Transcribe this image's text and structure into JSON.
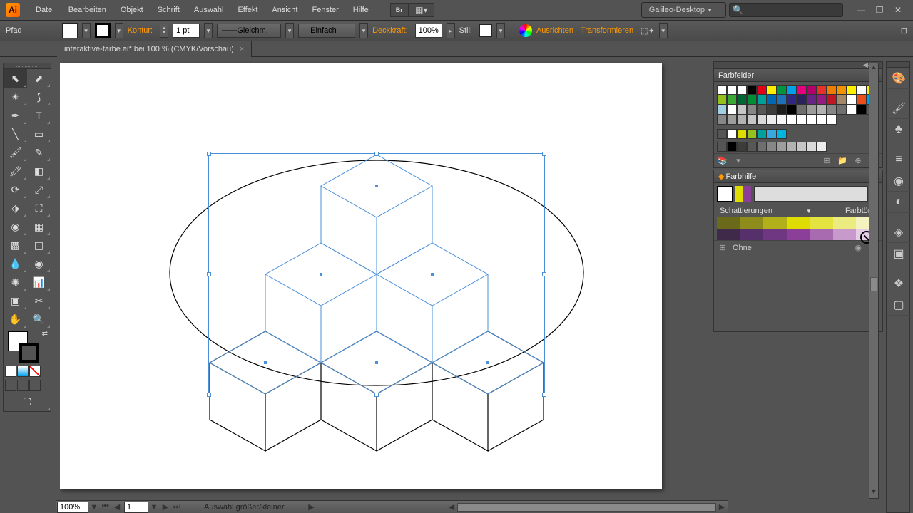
{
  "app": {
    "logo": "Ai"
  },
  "menu": [
    "Datei",
    "Bearbeiten",
    "Objekt",
    "Schrift",
    "Auswahl",
    "Effekt",
    "Ansicht",
    "Fenster",
    "Hilfe"
  ],
  "workspace": "Galileo-Desktop",
  "control": {
    "selection": "Pfad",
    "strokeLabel": "Kontur:",
    "strokeValue": "1 pt",
    "dash": "Gleichm.",
    "brush": "Einfach",
    "opacityLabel": "Deckkraft:",
    "opacityValue": "100%",
    "styleLabel": "Stil:",
    "align": "Ausrichten",
    "transform": "Transformieren"
  },
  "document": {
    "tab": "interaktive-farbe.ai* bei 100 % (CMYK/Vorschau)"
  },
  "status": {
    "zoom": "100%",
    "page": "1",
    "info": "Auswahl größer/kleiner"
  },
  "panels": {
    "swatches": {
      "title": "Farbfelder"
    },
    "guide": {
      "title": "Farbhilfe",
      "shadeLabel": "Schattierungen",
      "tintLabel": "Farbtöne",
      "footerText": "Ohne"
    }
  },
  "swatchColors": [
    [
      "#ffffff",
      "#ffffff",
      "#ffffff",
      "#000000",
      "#e2001a",
      "#ffed00",
      "#009640",
      "#00a0e9",
      "#e6007e",
      "#b5006c",
      "#e6332a",
      "#ef7d00",
      "#f39200",
      "#fff000",
      "#ffffff"
    ],
    [
      "#fff000",
      "#95c11f",
      "#3aaa35",
      "#006633",
      "#008d36",
      "#00a19a",
      "#0069b4",
      "#1d71b8",
      "#312783",
      "#29235c",
      "#662483",
      "#951b81",
      "#be1622",
      "#a5876a",
      "#ffffff"
    ],
    [
      "#e94e1b",
      "#009fe3",
      "#a3cfe6",
      "#ffffff",
      "#c6c6c6",
      "#878787",
      "#575756",
      "#3c3c3b",
      "#1d1d1b",
      "#000000",
      "#706f6f",
      "#9d9d9c",
      "#b2b2b2",
      "#868686",
      "#706f6f"
    ],
    [
      "#ffffff",
      "#000000",
      "#575756",
      "#878787",
      "#9d9d9c",
      "#b2b2b2",
      "#c6c6c6",
      "#dadada",
      "#ededed",
      "#f6f6f6",
      "#ffffff",
      "#ffffff",
      "#ffffff",
      "#ffffff",
      "#ffffff"
    ]
  ]
}
